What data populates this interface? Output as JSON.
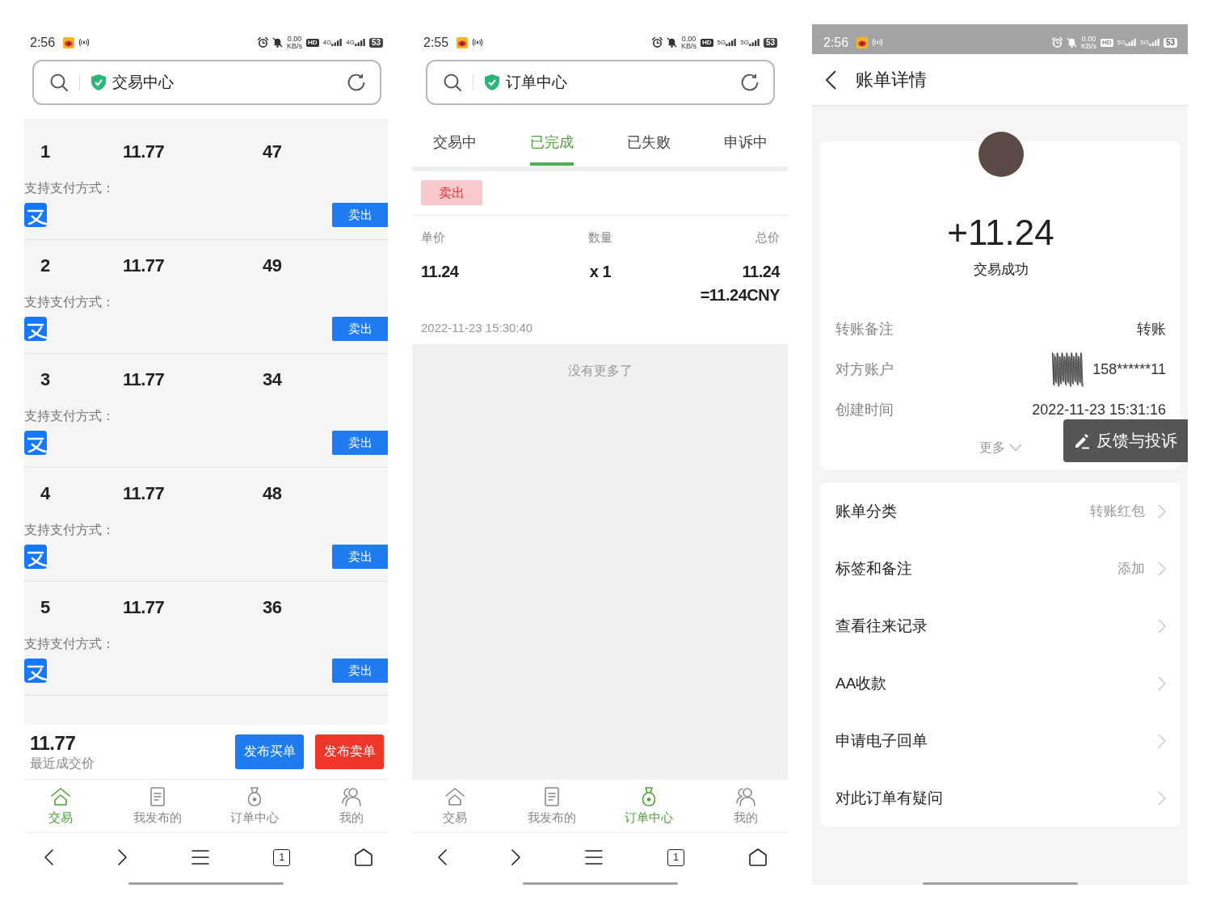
{
  "phones": [
    {
      "kind": "market",
      "status_bar": {
        "time": "2:56",
        "speed": "0.00",
        "speed_unit": "KB/s",
        "hd": "HD",
        "networks": [
          "4G",
          "4G"
        ],
        "battery": "53"
      },
      "address_bar": {
        "title": "交易中心"
      },
      "listings": [
        {
          "index": "1",
          "price": "11.77",
          "quantity": "47",
          "payment_label": "支持支付方式：",
          "action": "卖出"
        },
        {
          "index": "2",
          "price": "11.77",
          "quantity": "49",
          "payment_label": "支持支付方式：",
          "action": "卖出"
        },
        {
          "index": "3",
          "price": "11.77",
          "quantity": "34",
          "payment_label": "支持支付方式：",
          "action": "卖出"
        },
        {
          "index": "4",
          "price": "11.77",
          "quantity": "48",
          "payment_label": "支持支付方式：",
          "action": "卖出"
        },
        {
          "index": "5",
          "price": "11.77",
          "quantity": "36",
          "payment_label": "支持支付方式：",
          "action": "卖出"
        }
      ],
      "summary": {
        "price": "11.77",
        "caption": "最近成交价"
      },
      "buttons": [
        {
          "label": "发布买单",
          "kind": "buy"
        },
        {
          "label": "发布卖单",
          "kind": "sell"
        }
      ],
      "tab_bar": [
        {
          "label": "交易",
          "selected": true
        },
        {
          "label": "我发布的",
          "selected": false
        },
        {
          "label": "订单中心",
          "selected": false
        },
        {
          "label": "我的",
          "selected": false
        }
      ],
      "browser_nav": {
        "tab_count": "1"
      }
    },
    {
      "kind": "orders",
      "status_bar": {
        "time": "2:55",
        "speed": "0.00",
        "speed_unit": "KB/s",
        "hd": "HD",
        "networks": [
          "5G",
          "5G"
        ],
        "battery": "53"
      },
      "address_bar": {
        "title": "订单中心"
      },
      "order_tabs": [
        {
          "label": "交易中",
          "selected": false
        },
        {
          "label": "已完成",
          "selected": true
        },
        {
          "label": "已失败",
          "selected": false
        },
        {
          "label": "申诉中",
          "selected": false
        }
      ],
      "orders": [
        {
          "side": "卖出",
          "kind": "sell",
          "columns": [
            "单价",
            "数量",
            "总价"
          ],
          "unit_price": "11.24",
          "quantity": "x 1",
          "total": "11.24",
          "converted": "=11.24CNY",
          "time": "2022-11-23 15:30:40"
        }
      ],
      "end_note": "没有更多了",
      "tab_bar": [
        {
          "label": "交易",
          "selected": false
        },
        {
          "label": "我发布的",
          "selected": false
        },
        {
          "label": "订单中心",
          "selected": true
        },
        {
          "label": "我的",
          "selected": false
        }
      ],
      "browser_nav": {
        "tab_count": "1"
      }
    },
    {
      "kind": "bill",
      "status_bar": {
        "time": "2:56",
        "speed": "0.00",
        "speed_unit": "KB/s",
        "hd": "HD",
        "networks": [
          "5G",
          "5G"
        ],
        "battery": "53",
        "shaded": true
      },
      "header": {
        "title": "账单详情"
      },
      "summary": {
        "amount": "+11.24",
        "status": "交易成功"
      },
      "details": [
        {
          "label": "转账备注",
          "value": "转账",
          "redacted": false
        },
        {
          "label": "对方账户",
          "value": "158******11",
          "redacted": true
        },
        {
          "label": "创建时间",
          "value": "2022-11-23 15:31:16",
          "redacted": false
        }
      ],
      "more": "更多",
      "feedback_button": "反馈与投诉",
      "actions": [
        {
          "label": "账单分类",
          "value": "转账红包"
        },
        {
          "label": "标签和备注",
          "value": "添加"
        },
        {
          "label": "查看往来记录"
        },
        {
          "label": "AA收款"
        },
        {
          "label": "申请电子回单"
        },
        {
          "label": "对此订单有疑问"
        }
      ]
    }
  ]
}
